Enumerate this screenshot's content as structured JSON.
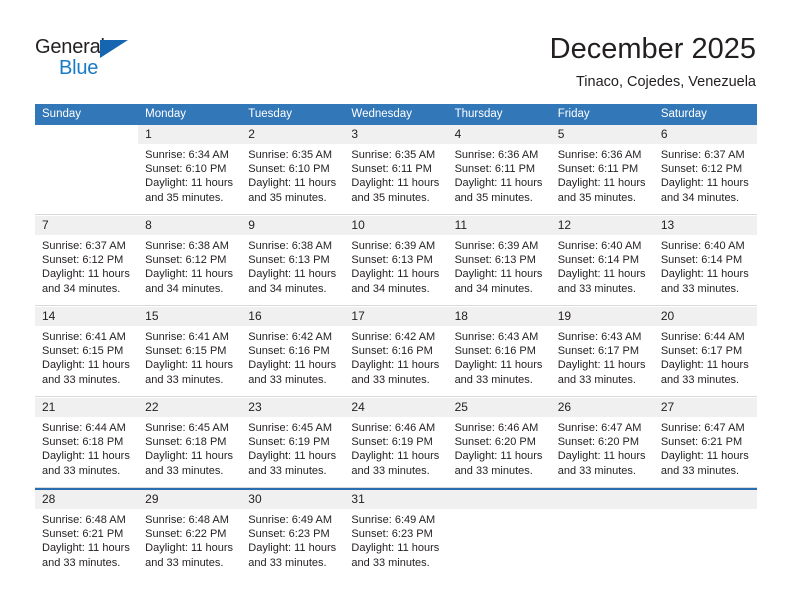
{
  "brand": {
    "name_part1": "General",
    "name_part2": "Blue",
    "accent_color": "#1a7bc6",
    "triangle_color": "#1565b0"
  },
  "header": {
    "month_title": "December 2025",
    "location": "Tinaco, Cojedes, Venezuela"
  },
  "calendar": {
    "header_background": "#3277b8",
    "daynum_background": "#f0f0f0",
    "weekdays": [
      "Sunday",
      "Monday",
      "Tuesday",
      "Wednesday",
      "Thursday",
      "Friday",
      "Saturday"
    ],
    "weeks": [
      [
        {
          "day": "",
          "sunrise": "",
          "sunset": "",
          "daylight": "",
          "blank": true
        },
        {
          "day": "1",
          "sunrise": "Sunrise: 6:34 AM",
          "sunset": "Sunset: 6:10 PM",
          "daylight": "Daylight: 11 hours and 35 minutes."
        },
        {
          "day": "2",
          "sunrise": "Sunrise: 6:35 AM",
          "sunset": "Sunset: 6:10 PM",
          "daylight": "Daylight: 11 hours and 35 minutes."
        },
        {
          "day": "3",
          "sunrise": "Sunrise: 6:35 AM",
          "sunset": "Sunset: 6:11 PM",
          "daylight": "Daylight: 11 hours and 35 minutes."
        },
        {
          "day": "4",
          "sunrise": "Sunrise: 6:36 AM",
          "sunset": "Sunset: 6:11 PM",
          "daylight": "Daylight: 11 hours and 35 minutes."
        },
        {
          "day": "5",
          "sunrise": "Sunrise: 6:36 AM",
          "sunset": "Sunset: 6:11 PM",
          "daylight": "Daylight: 11 hours and 35 minutes."
        },
        {
          "day": "6",
          "sunrise": "Sunrise: 6:37 AM",
          "sunset": "Sunset: 6:12 PM",
          "daylight": "Daylight: 11 hours and 34 minutes."
        }
      ],
      [
        {
          "day": "7",
          "sunrise": "Sunrise: 6:37 AM",
          "sunset": "Sunset: 6:12 PM",
          "daylight": "Daylight: 11 hours and 34 minutes."
        },
        {
          "day": "8",
          "sunrise": "Sunrise: 6:38 AM",
          "sunset": "Sunset: 6:12 PM",
          "daylight": "Daylight: 11 hours and 34 minutes."
        },
        {
          "day": "9",
          "sunrise": "Sunrise: 6:38 AM",
          "sunset": "Sunset: 6:13 PM",
          "daylight": "Daylight: 11 hours and 34 minutes."
        },
        {
          "day": "10",
          "sunrise": "Sunrise: 6:39 AM",
          "sunset": "Sunset: 6:13 PM",
          "daylight": "Daylight: 11 hours and 34 minutes."
        },
        {
          "day": "11",
          "sunrise": "Sunrise: 6:39 AM",
          "sunset": "Sunset: 6:13 PM",
          "daylight": "Daylight: 11 hours and 34 minutes."
        },
        {
          "day": "12",
          "sunrise": "Sunrise: 6:40 AM",
          "sunset": "Sunset: 6:14 PM",
          "daylight": "Daylight: 11 hours and 33 minutes."
        },
        {
          "day": "13",
          "sunrise": "Sunrise: 6:40 AM",
          "sunset": "Sunset: 6:14 PM",
          "daylight": "Daylight: 11 hours and 33 minutes."
        }
      ],
      [
        {
          "day": "14",
          "sunrise": "Sunrise: 6:41 AM",
          "sunset": "Sunset: 6:15 PM",
          "daylight": "Daylight: 11 hours and 33 minutes."
        },
        {
          "day": "15",
          "sunrise": "Sunrise: 6:41 AM",
          "sunset": "Sunset: 6:15 PM",
          "daylight": "Daylight: 11 hours and 33 minutes."
        },
        {
          "day": "16",
          "sunrise": "Sunrise: 6:42 AM",
          "sunset": "Sunset: 6:16 PM",
          "daylight": "Daylight: 11 hours and 33 minutes."
        },
        {
          "day": "17",
          "sunrise": "Sunrise: 6:42 AM",
          "sunset": "Sunset: 6:16 PM",
          "daylight": "Daylight: 11 hours and 33 minutes."
        },
        {
          "day": "18",
          "sunrise": "Sunrise: 6:43 AM",
          "sunset": "Sunset: 6:16 PM",
          "daylight": "Daylight: 11 hours and 33 minutes."
        },
        {
          "day": "19",
          "sunrise": "Sunrise: 6:43 AM",
          "sunset": "Sunset: 6:17 PM",
          "daylight": "Daylight: 11 hours and 33 minutes."
        },
        {
          "day": "20",
          "sunrise": "Sunrise: 6:44 AM",
          "sunset": "Sunset: 6:17 PM",
          "daylight": "Daylight: 11 hours and 33 minutes."
        }
      ],
      [
        {
          "day": "21",
          "sunrise": "Sunrise: 6:44 AM",
          "sunset": "Sunset: 6:18 PM",
          "daylight": "Daylight: 11 hours and 33 minutes."
        },
        {
          "day": "22",
          "sunrise": "Sunrise: 6:45 AM",
          "sunset": "Sunset: 6:18 PM",
          "daylight": "Daylight: 11 hours and 33 minutes."
        },
        {
          "day": "23",
          "sunrise": "Sunrise: 6:45 AM",
          "sunset": "Sunset: 6:19 PM",
          "daylight": "Daylight: 11 hours and 33 minutes."
        },
        {
          "day": "24",
          "sunrise": "Sunrise: 6:46 AM",
          "sunset": "Sunset: 6:19 PM",
          "daylight": "Daylight: 11 hours and 33 minutes."
        },
        {
          "day": "25",
          "sunrise": "Sunrise: 6:46 AM",
          "sunset": "Sunset: 6:20 PM",
          "daylight": "Daylight: 11 hours and 33 minutes."
        },
        {
          "day": "26",
          "sunrise": "Sunrise: 6:47 AM",
          "sunset": "Sunset: 6:20 PM",
          "daylight": "Daylight: 11 hours and 33 minutes."
        },
        {
          "day": "27",
          "sunrise": "Sunrise: 6:47 AM",
          "sunset": "Sunset: 6:21 PM",
          "daylight": "Daylight: 11 hours and 33 minutes."
        }
      ],
      [
        {
          "day": "28",
          "sunrise": "Sunrise: 6:48 AM",
          "sunset": "Sunset: 6:21 PM",
          "daylight": "Daylight: 11 hours and 33 minutes."
        },
        {
          "day": "29",
          "sunrise": "Sunrise: 6:48 AM",
          "sunset": "Sunset: 6:22 PM",
          "daylight": "Daylight: 11 hours and 33 minutes."
        },
        {
          "day": "30",
          "sunrise": "Sunrise: 6:49 AM",
          "sunset": "Sunset: 6:23 PM",
          "daylight": "Daylight: 11 hours and 33 minutes."
        },
        {
          "day": "31",
          "sunrise": "Sunrise: 6:49 AM",
          "sunset": "Sunset: 6:23 PM",
          "daylight": "Daylight: 11 hours and 33 minutes."
        },
        {
          "day": "",
          "sunrise": "",
          "sunset": "",
          "daylight": "",
          "empty": true
        },
        {
          "day": "",
          "sunrise": "",
          "sunset": "",
          "daylight": "",
          "empty": true
        },
        {
          "day": "",
          "sunrise": "",
          "sunset": "",
          "daylight": "",
          "empty": true
        }
      ]
    ]
  }
}
